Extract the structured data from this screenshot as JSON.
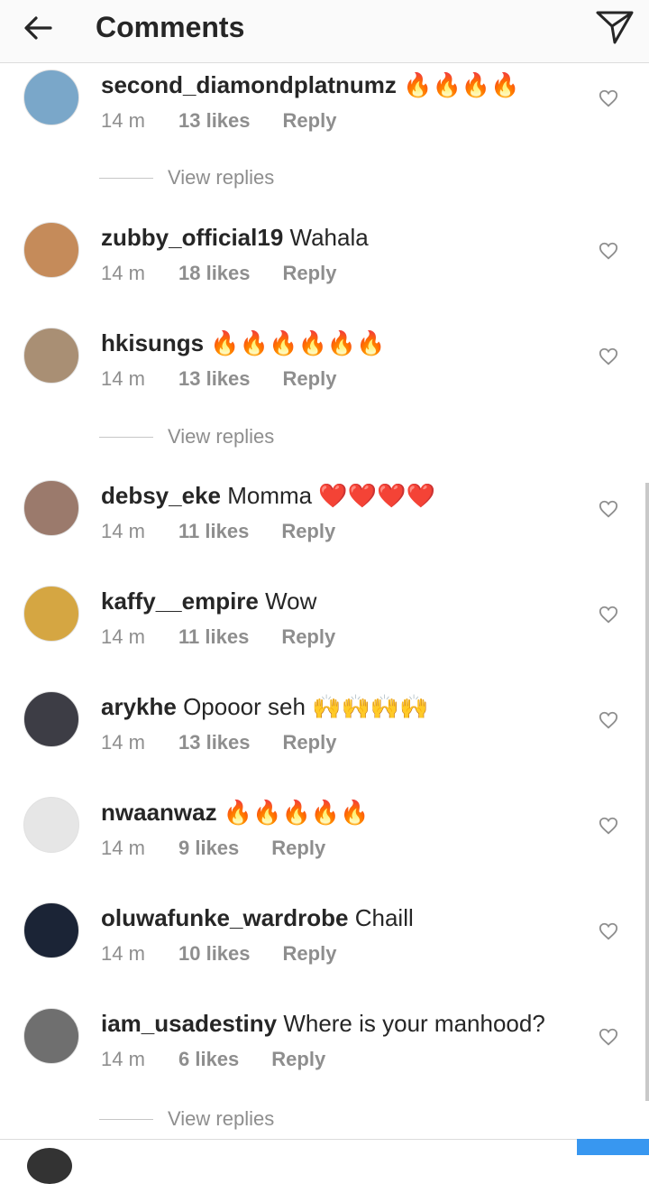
{
  "header": {
    "title": "Comments"
  },
  "comments": [
    {
      "username": "second_diamondplatnumz",
      "text": " 🔥🔥🔥🔥",
      "time": "14 m",
      "likes": "13 likes",
      "reply": "Reply",
      "avatar_color": "#7aa7c9",
      "has_view_replies": true
    },
    {
      "username": "zubby_official19",
      "text": " Wahala",
      "time": "14 m",
      "likes": "18 likes",
      "reply": "Reply",
      "avatar_color": "#c58b5a",
      "has_view_replies": false
    },
    {
      "username": "hkisungs",
      "text": " 🔥🔥🔥🔥🔥🔥",
      "time": "14 m",
      "likes": "13 likes",
      "reply": "Reply",
      "avatar_color": "#a98f74",
      "has_view_replies": true
    },
    {
      "username": "debsy_eke",
      "text": " Momma ❤️❤️❤️❤️",
      "time": "14 m",
      "likes": "11 likes",
      "reply": "Reply",
      "avatar_color": "#9b7a6c",
      "has_view_replies": false
    },
    {
      "username": "kaffy__empire",
      "text": " Wow",
      "time": "14 m",
      "likes": "11 likes",
      "reply": "Reply",
      "avatar_color": "#d5a642",
      "has_view_replies": false
    },
    {
      "username": "arykhe",
      "text": " Opooor seh 🙌🙌🙌🙌",
      "time": "14 m",
      "likes": "13 likes",
      "reply": "Reply",
      "avatar_color": "#3d3d45",
      "has_view_replies": false
    },
    {
      "username": "nwaanwaz",
      "text": " 🔥🔥🔥🔥🔥",
      "time": "14 m",
      "likes": "9 likes",
      "reply": "Reply",
      "avatar_color": "#e6e6e6",
      "has_view_replies": false
    },
    {
      "username": "oluwafunke_wardrobe",
      "text": " Chaill",
      "time": "14 m",
      "likes": "10 likes",
      "reply": "Reply",
      "avatar_color": "#1b2436",
      "has_view_replies": false
    },
    {
      "username": "iam_usadestiny",
      "text": " Where is your manhood?",
      "time": "14 m",
      "likes": "6 likes",
      "reply": "Reply",
      "avatar_color": "#6f6f6f",
      "has_view_replies": true
    }
  ],
  "view_replies_label": "View replies",
  "colors": {
    "text": "#262626",
    "muted": "#8e8e8e",
    "accent": "#3897f0"
  }
}
